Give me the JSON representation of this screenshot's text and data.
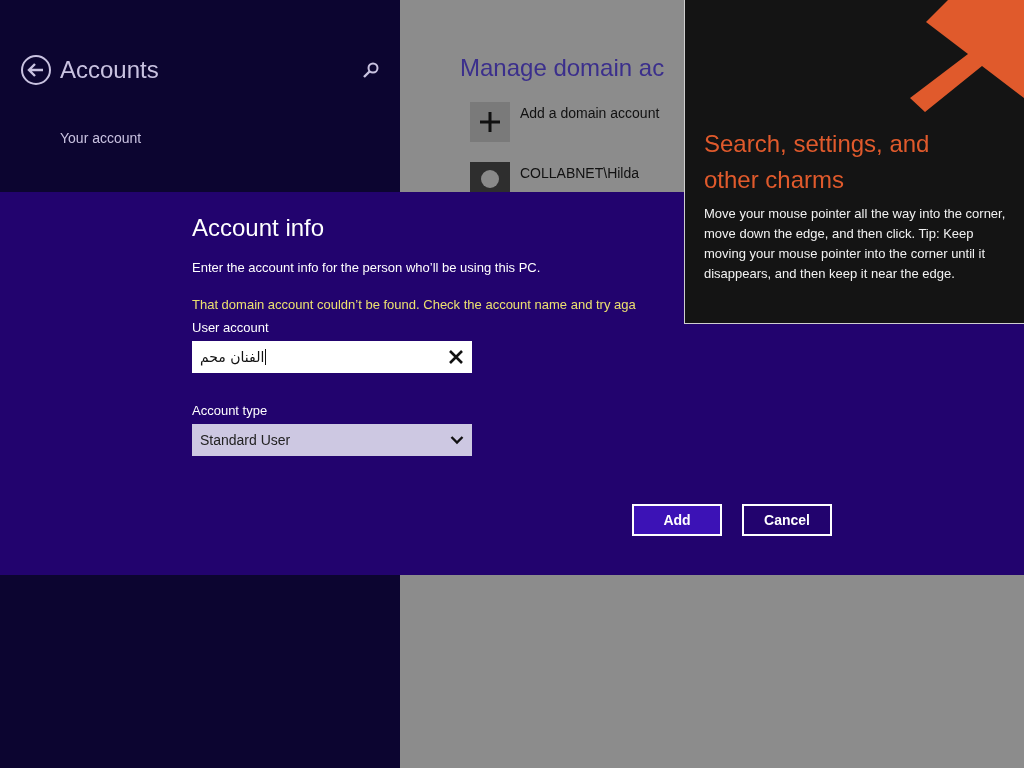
{
  "sidebar": {
    "title": "Accounts",
    "items": [
      {
        "label": "Your account"
      }
    ]
  },
  "main": {
    "title": "Manage domain ac",
    "actions": [
      {
        "label": "Add a domain account"
      }
    ],
    "accounts": [
      {
        "name": "COLLABNET\\Hilda"
      }
    ]
  },
  "dialog": {
    "title": "Account info",
    "description": "Enter the account info for the person who’ll be using this PC.",
    "error": "That domain account couldn’t be found. Check the account name and try aga",
    "fields": [
      {
        "kind": "text",
        "label": "User account",
        "value": "الفنان محم"
      },
      {
        "kind": "select",
        "label": "Account type",
        "value": "Standard User"
      }
    ],
    "buttons": [
      {
        "label": "Add",
        "kind": "primary"
      },
      {
        "label": "Cancel",
        "kind": "secondary"
      }
    ]
  },
  "tip": {
    "title": "Search, settings, and other charms",
    "body": "Move your mouse pointer all the way into the corner, move down the edge, and then click. Tip: Keep moving your mouse pointer into the corner until it disappears, and then keep it near the edge."
  }
}
